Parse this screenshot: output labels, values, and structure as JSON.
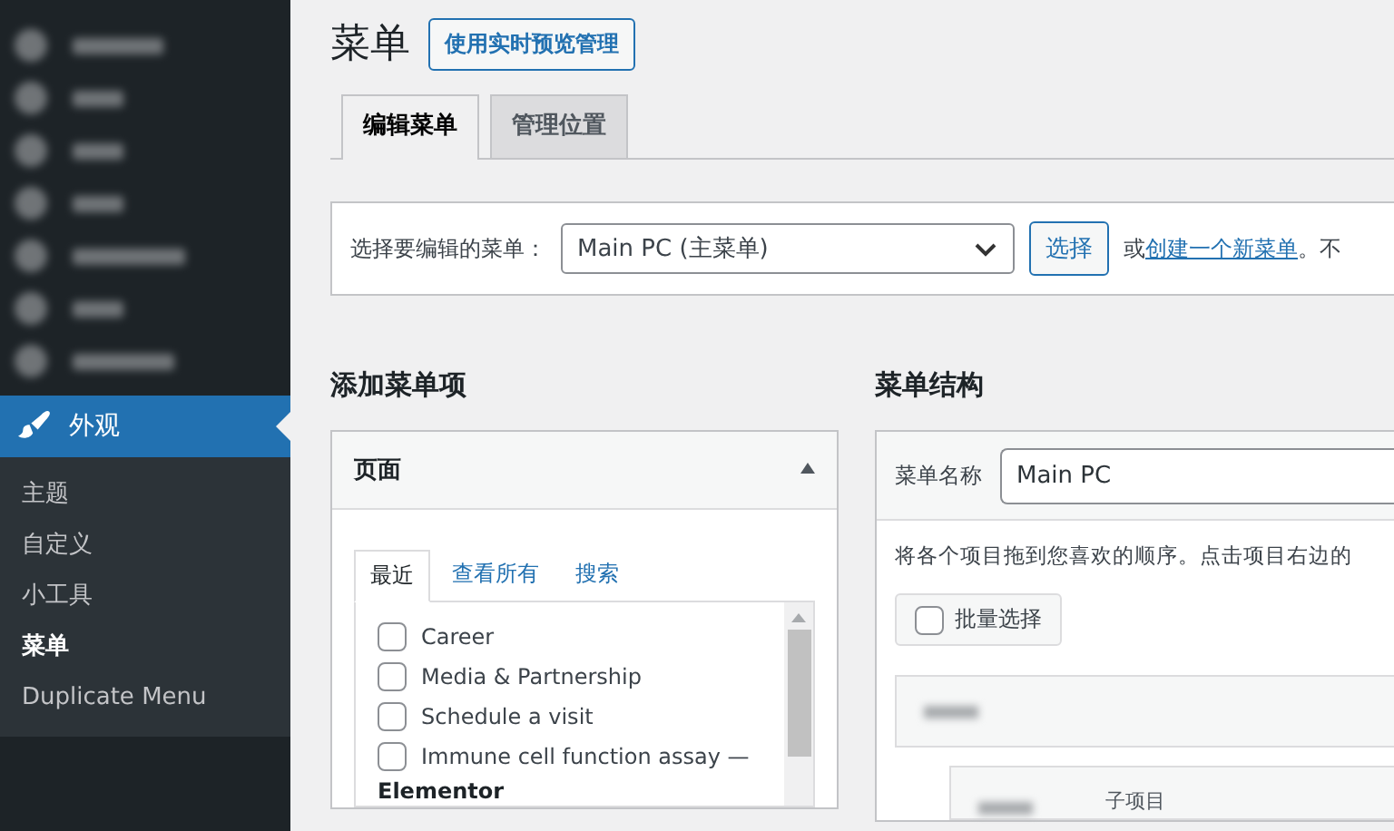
{
  "sidebar": {
    "active_menu": {
      "label": "外观",
      "selected": true
    },
    "submenu": [
      {
        "label": "主题",
        "selected": false
      },
      {
        "label": "自定义",
        "selected": false
      },
      {
        "label": "小工具",
        "selected": false
      },
      {
        "label": "菜单",
        "selected": true
      },
      {
        "label": "Duplicate Menu",
        "selected": false
      }
    ]
  },
  "page": {
    "title": "菜单",
    "action_button": "使用实时预览管理"
  },
  "tabs": [
    {
      "label": "编辑菜单",
      "selected": true
    },
    {
      "label": "管理位置",
      "selected": false
    }
  ],
  "menu_select": {
    "label": "选择要编辑的菜单：",
    "value": "Main PC (主菜单)",
    "button": "选择",
    "or_text": "或",
    "create_link": "创建一个新菜单",
    "trailing": "。不"
  },
  "add_items": {
    "heading": "添加菜单项",
    "panel_title": "页面",
    "expanded": true,
    "tabs": [
      {
        "label": "最近",
        "selected": true
      },
      {
        "label": "查看所有",
        "selected": false
      },
      {
        "label": "搜索",
        "selected": false
      }
    ],
    "pages": [
      {
        "label": "Career",
        "checked": false
      },
      {
        "label": "Media & Partnership",
        "checked": false
      },
      {
        "label": "Schedule a visit",
        "checked": false
      },
      {
        "label": "Immune cell function assay —",
        "checked": false
      }
    ],
    "group_label": "Elementor"
  },
  "structure": {
    "heading": "菜单结构",
    "name_label": "菜单名称",
    "name_value": "Main PC",
    "instructions": "将各个项目拖到您喜欢的顺序。点击项目右边的",
    "bulk_select": {
      "label": "批量选择",
      "checked": false
    },
    "sub_item_label": "子项目"
  }
}
